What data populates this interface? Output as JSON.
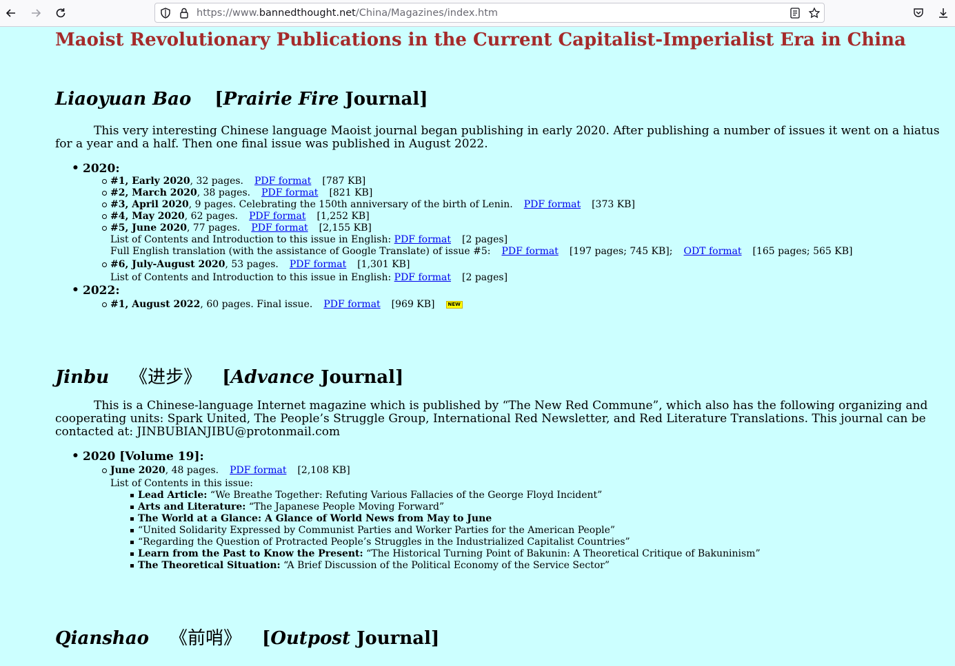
{
  "browser": {
    "url_prefix": "https://www.",
    "url_host": "bannedthought.net",
    "url_path": "/China/Magazines/index.htm"
  },
  "page": {
    "title": "Maoist Revolutionary Publications in the Current Capitalist-Imperialist Era in China"
  },
  "liaoyuan": {
    "name": "Liaoyuan Bao",
    "bracket_open": "[",
    "eng_name": "Prairie Fire",
    "suffix": " Journal]",
    "intro": "This very interesting Chinese language Maoist journal began publishing in early 2020. After publishing a number of issues it went on a hiatus for a year and a half. Then one final issue was published in August 2022.",
    "year_2020": "2020:",
    "year_2022": "2022:",
    "issues": [
      {
        "num": "#1, Early 2020",
        "rest": ", 32 pages.",
        "link": "PDF format",
        "size": "[787 KB]"
      },
      {
        "num": "#2, March 2020",
        "rest": ", 38 pages.",
        "link": "PDF format",
        "size": "[821 KB]"
      },
      {
        "num": "#3, April 2020",
        "rest": ", 9 pages. Celebrating the 150th anniversary of the birth of Lenin.",
        "link": "PDF format",
        "size": "[373 KB]"
      },
      {
        "num": "#4, May 2020",
        "rest": ", 62 pages.",
        "link": "PDF format",
        "size": "[1,252 KB]"
      },
      {
        "num": "#5, June 2020",
        "rest": ", 77 pages.",
        "link": "PDF format",
        "size": "[2,155 KB]"
      },
      {
        "num": "#6, July-August 2020",
        "rest": ", 53 pages.",
        "link": "PDF format",
        "size": "[1,301 KB]"
      }
    ],
    "i5_contents": {
      "text": "List of Contents and Introduction to this issue in English:",
      "link": "PDF format",
      "size": "[2 pages]"
    },
    "i5_translation": {
      "text": "Full English translation (with the assistance of Google Translate) of issue #5:",
      "link1": "PDF format",
      "size1": "[197 pages; 745 KB];",
      "link2": "ODT format",
      "size2": "[165 pages; 565 KB]"
    },
    "i6_contents": {
      "text": "List of Contents and Introduction to this issue in English:",
      "link": "PDF format",
      "size": "[2 pages]"
    },
    "final": {
      "num": "#1, August 2022",
      "rest": ", 60 pages. Final issue.",
      "link": "PDF format",
      "size": "[969 KB]",
      "badge": "NEW"
    }
  },
  "jinbu": {
    "name": "Jinbu",
    "chinese": "《进步》",
    "bracket_open": "[",
    "eng_name": "Advance",
    "suffix": " Journal]",
    "intro": "This is a Chinese-language Internet magazine which is published by “The New Red Commune”, which also has the following organizing and cooperating units: Spark United, The People’s Struggle Group, International Red Newsletter, and Red Literature Translations. This journal can be contacted at: JINBUBIANJIBU@protonmail.com",
    "year": "2020 [Volume 19]:",
    "issue": {
      "num": "June 2020",
      "rest": ", 48 pages.",
      "link": "PDF format",
      "size": "[2,108 KB]"
    },
    "contents_label": "List of Contents in this issue:",
    "contents": [
      {
        "bold": "Lead Article:",
        "text": " “We Breathe Together: Refuting Various Fallacies of the George Floyd Incident”"
      },
      {
        "bold": "Arts and Literature:",
        "text": " “The Japanese People Moving Forward”"
      },
      {
        "bold": "The World at a Glance: A Glance of World News from May to June",
        "text": ""
      },
      {
        "bold": "",
        "text": "“United Solidarity Expressed by Communist Parties and Worker Parties for the American People”"
      },
      {
        "bold": "",
        "text": "“Regarding the Question of Protracted People’s Struggles in the Industrialized Capitalist Countries”"
      },
      {
        "bold": "Learn from the Past to Know the Present:",
        "text": " “The Historical Turning Point of Bakunin: A Theoretical Critique of Bakuninism”"
      },
      {
        "bold": "The Theoretical Situation:",
        "text": " “A Brief Discussion of the Political Economy of the Service Sector”"
      }
    ]
  },
  "qianshao": {
    "name": "Qianshao",
    "chinese": "《前哨》",
    "bracket_open": "[",
    "eng_name": "Outpost",
    "suffix": " Journal]"
  },
  "colors": {
    "page_bg": "#ccffff",
    "title": "#a52a2a",
    "link": "#0000ee"
  }
}
